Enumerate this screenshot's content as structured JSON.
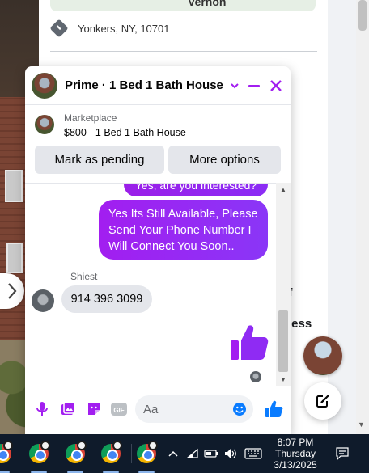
{
  "listing": {
    "map_label": "Vernon",
    "location": "Yonkers, NY, 10701",
    "fragment_1": "ff",
    "fragment_2": "less"
  },
  "chat": {
    "title": "Prime · 1 Bed 1 Bath House",
    "marketplace_label": "Marketplace",
    "listing_title": "$800 - 1 Bed 1 Bath House",
    "actions": {
      "mark_pending": "Mark as pending",
      "more_options": "More options"
    },
    "messages": {
      "previous_partial": "Yes, are you interested?",
      "outgoing": "Yes Its Still Available, Please Send Your Phone Number I Will Connect You Soon..",
      "sender_name": "Shiest",
      "incoming": "914 396 3099"
    },
    "composer": {
      "placeholder": "Aa"
    }
  },
  "taskbar": {
    "time": "8:07 PM",
    "day": "Thursday",
    "date": "3/13/2025"
  },
  "colors": {
    "accent_purple": "#a21ef0",
    "messenger_blue": "#0a7cff",
    "taskbar_bg": "#0f1b2b"
  },
  "icons": [
    "directions-icon",
    "chevron-right-icon",
    "chevron-down-icon",
    "minimize-icon",
    "close-icon",
    "microphone-icon",
    "image-icon",
    "sticker-icon",
    "gif-icon",
    "emoji-icon",
    "thumbs-up-icon",
    "new-message-icon",
    "chrome-icon",
    "wifi-icon",
    "battery-icon",
    "volume-icon",
    "keyboard-icon",
    "notification-icon"
  ]
}
